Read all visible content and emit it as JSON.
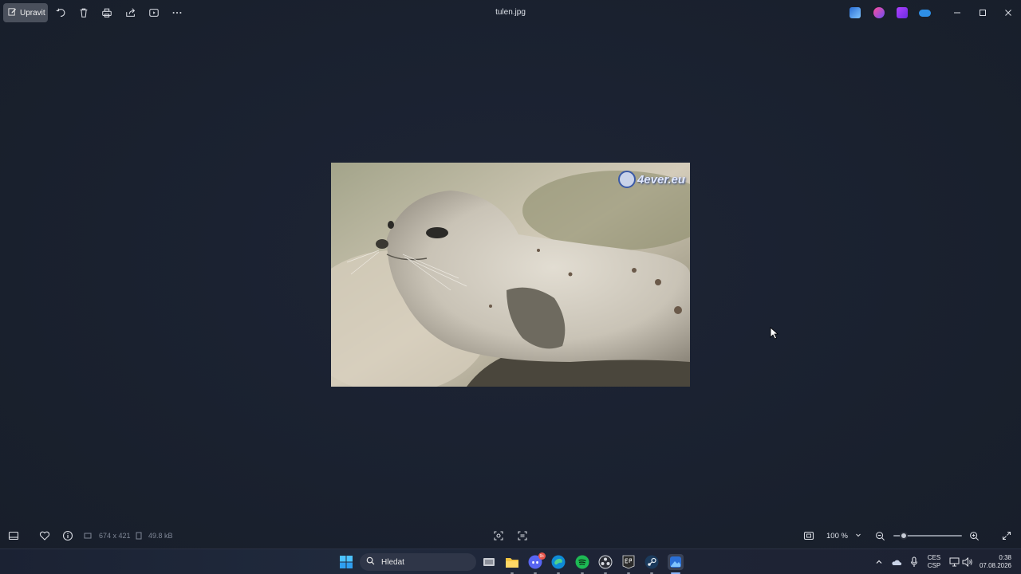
{
  "window": {
    "title": "tulen.jpg",
    "edit_label": "Upravit"
  },
  "toolbar": {
    "icons": [
      "pencil-edit-icon",
      "rotate-icon",
      "trash-icon",
      "print-icon",
      "share-icon",
      "slideshow-icon",
      "more-icon"
    ],
    "apps": [
      "photos-app-icon",
      "clipchamp-icon",
      "designer-icon",
      "onedrive-icon"
    ]
  },
  "image": {
    "watermark": "4ever.eu"
  },
  "status": {
    "dimensions": "674 x 421",
    "file_size": "49.8 kB",
    "zoom": "100 %",
    "zoom_slider_fraction": 0.15
  },
  "taskbar": {
    "search_placeholder": "Hledat",
    "discord_badge": "9+",
    "language": "CES",
    "layout": "CSP",
    "time": "0:38",
    "date": "07.08.2026"
  },
  "colors": {
    "background": "#1b2231",
    "taskbar": "#202a3d",
    "accent": "#8ab4f8"
  }
}
